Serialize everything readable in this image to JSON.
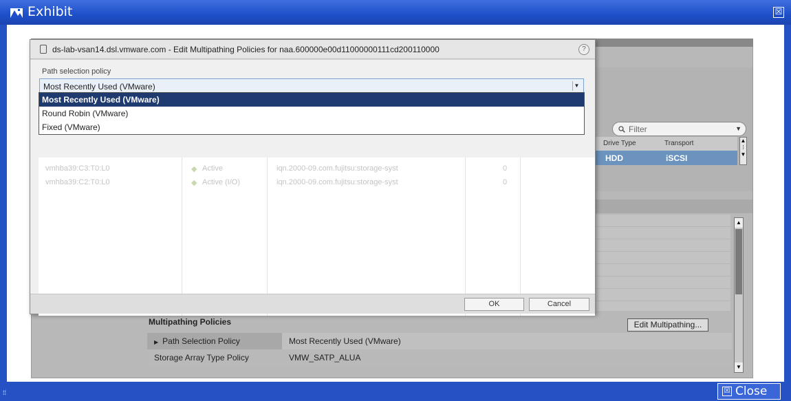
{
  "window": {
    "title": "Exhibit",
    "close_label": "Close",
    "close_glyph": "☒"
  },
  "dialog": {
    "title": "ds-lab-vsan14.dsl.vmware.com - Edit Multipathing Policies for naa.600000e00d11000000111cd200110000",
    "help_glyph": "?",
    "path_selection_label": "Path selection policy",
    "selected_value": "Most Recently Used (VMware)",
    "options": [
      "Most Recently Used (VMware)",
      "Round Robin (VMware)",
      "Fixed (VMware)"
    ],
    "paths": [
      {
        "name": "vmhba39:C3:T0:L0",
        "status": "Active",
        "target": "iqn.2000-09.com.fujitsu:storage-syst",
        "lun": "0"
      },
      {
        "name": "vmhba39:C2:T0:L0",
        "status": "Active (I/O)",
        "target": "iqn.2000-09.com.fujitsu:storage-syst",
        "lun": "0"
      }
    ],
    "ok_label": "OK",
    "cancel_label": "Cancel"
  },
  "background": {
    "filter_placeholder": "Filter",
    "devices_table": {
      "headers": [
        "Drive Type",
        "Transport"
      ],
      "row": [
        "HDD",
        "iSCSI"
      ]
    },
    "multipathing": {
      "title": "Multipathing Policies",
      "edit_button": "Edit Multipathing...",
      "rows": [
        {
          "label": "Path Selection Policy",
          "value": "Most Recently Used (VMware)"
        },
        {
          "label": "Storage Array Type Policy",
          "value": "VMW_SATP_ALUA"
        }
      ]
    }
  },
  "colors": {
    "window_blue": "#2452c4",
    "selected_option": "#1f3a6e",
    "selected_row": "#6b93bd"
  }
}
